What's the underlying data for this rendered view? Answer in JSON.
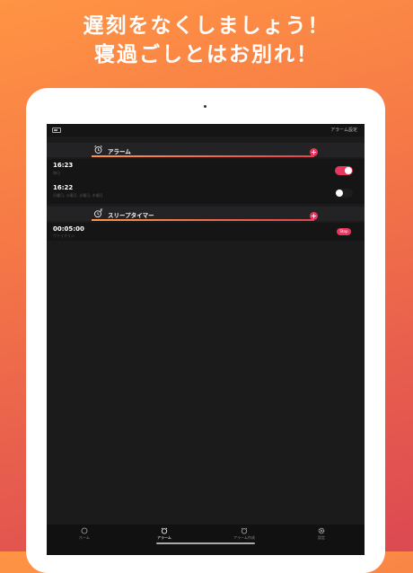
{
  "headline": {
    "line1": "遅刻をなくしましょう！",
    "line2": "寝過ごしとはお別れ！"
  },
  "colors": {
    "accent": "#e8375f",
    "gradient_start": "#ff9444",
    "gradient_end": "#dc4952"
  },
  "statusbar": {
    "top_right_link": "アラーム設定"
  },
  "alarm_section": {
    "title": "アラーム",
    "icon": "alarm-clock-icon",
    "add_icon": "plus-icon"
  },
  "alarms": [
    {
      "time": "16:23",
      "sub": "毎日",
      "enabled": true
    },
    {
      "time": "16:22",
      "sub": "月曜日, 火曜日, 水曜日, 木曜日",
      "enabled": false
    }
  ],
  "sleep_section": {
    "title": "スリープタイマー",
    "icon": "sleep-timer-icon",
    "add_icon": "plus-icon"
  },
  "sleep_timers": [
    {
      "time": "00:05:00",
      "sub": "ヴァイオリン",
      "button": "Stop"
    }
  ],
  "tabs": [
    {
      "label": "ホーム",
      "icon": "home-icon",
      "active": false
    },
    {
      "label": "アラーム",
      "icon": "alarm-clock-icon",
      "active": true
    },
    {
      "label": "アラーム作成",
      "icon": "alarm-add-icon",
      "active": false
    },
    {
      "label": "設定",
      "icon": "gear-icon",
      "active": false
    }
  ]
}
